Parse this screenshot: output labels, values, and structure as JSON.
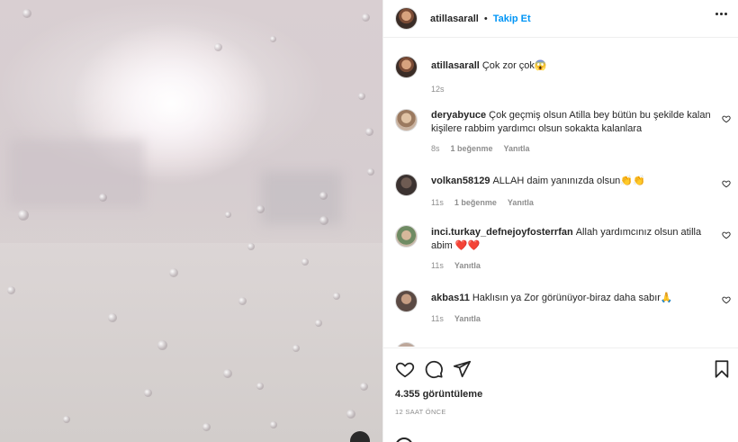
{
  "post": {
    "username": "atillasarall",
    "separator": "•",
    "follow_label": "Takip Et",
    "caption": "Çok zor çok😱",
    "caption_time": "12s"
  },
  "comments": [
    {
      "user": "deryabyuce",
      "text": "Çok geçmiş olsun Atilla bey bütün bu şekilde kalan kişilere rabbim yardımcı olsun sokakta kalanlara",
      "time": "8s",
      "likes": "1 beğenme",
      "reply": "Yanıtla"
    },
    {
      "user": "volkan58129",
      "text": "ALLAH daim yanınızda olsun👏👏",
      "time": "11s",
      "likes": "1 beğenme",
      "reply": "Yanıtla"
    },
    {
      "user": "inci.turkay_defnejoyfosterrfan",
      "text": "Allah yardımcınız olsun atilla abim ❤️❤️",
      "time": "11s",
      "reply": "Yanıtla"
    },
    {
      "user": "akbas11",
      "text": "Haklısın ya Zor görünüyor-biraz daha sabır🙏",
      "time": "11s",
      "reply": "Yanıtla"
    }
  ],
  "stats": {
    "views": "4.355 görüntüleme",
    "posted": "12 SAAT ÖNCE"
  },
  "icons": {
    "like": "heart-icon",
    "comment": "comment-icon",
    "share": "share-icon",
    "save": "bookmark-icon",
    "more": "more-options-icon"
  },
  "colors": {
    "accent": "#0095f6",
    "text": "#262626",
    "muted": "#8e8e8e"
  }
}
